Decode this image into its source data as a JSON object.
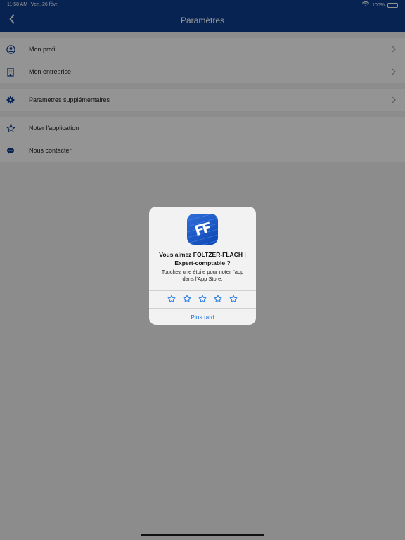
{
  "status_bar": {
    "time": "11:58 AM",
    "date": "Ven. 26 févr.",
    "battery": "100%"
  },
  "nav": {
    "title": "Paramètres"
  },
  "settings": {
    "group1": [
      {
        "label": "Mon profil",
        "icon": "person-circle-icon"
      },
      {
        "label": "Mon entreprise",
        "icon": "building-icon"
      }
    ],
    "group2": [
      {
        "label": "Paramètres supplémentaires",
        "icon": "gear-icon"
      }
    ],
    "group3": [
      {
        "label": "Noter l'application",
        "icon": "star-outline-icon"
      },
      {
        "label": "Nous contacter",
        "icon": "speech-bubble-icon"
      }
    ]
  },
  "rating_alert": {
    "app_icon_text": "FF",
    "title": "Vous aimez FOLTZER-FLACH | Expert-comptable ?",
    "message": "Touchez une étoile pour noter l'app dans l'App Store.",
    "stars": 5,
    "later_label": "Plus tard"
  },
  "colors": {
    "brand": "#0d3d8e",
    "link": "#1a73e8"
  }
}
